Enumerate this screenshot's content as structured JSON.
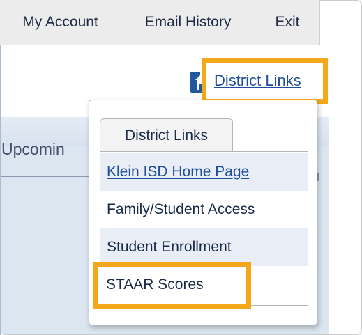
{
  "topnav": {
    "my_account": "My Account",
    "email_history": "Email History",
    "exit": "Exit"
  },
  "background": {
    "upcoming_text": "Upcomin"
  },
  "district_links": {
    "trigger_label": "District Links",
    "tab_label": "District Links",
    "items": [
      {
        "label": "Klein ISD Home Page"
      },
      {
        "label": "Family/Student Access"
      },
      {
        "label": "Student Enrollment"
      },
      {
        "label": "STAAR Scores"
      }
    ]
  },
  "colors": {
    "highlight": "#f4a71a",
    "link": "#1f4e9b",
    "icon_bg": "#1f5a9e"
  },
  "icons": {
    "district": "school-building-icon"
  }
}
